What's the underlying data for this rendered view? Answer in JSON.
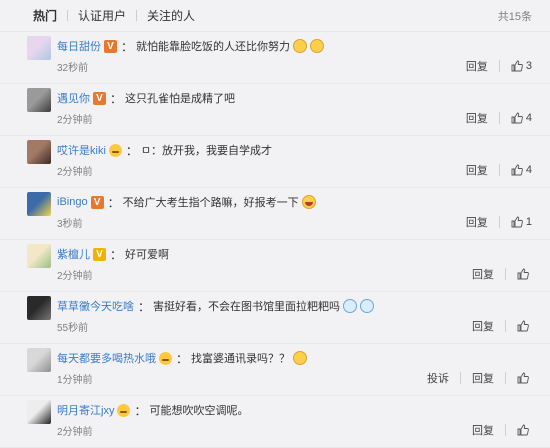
{
  "tabs": [
    {
      "label": "热门",
      "active": true
    },
    {
      "label": "认证用户",
      "active": false
    },
    {
      "label": "关注的人",
      "active": false
    }
  ],
  "total": "共15条",
  "reply_label": "回复",
  "report_label": "投诉",
  "comments": [
    {
      "name": "每日甜份",
      "badge": "V",
      "text": "就怕能靠脸吃饭的人还比你努力",
      "emojis": [
        "face",
        "face"
      ],
      "time": "32秒前",
      "likes": "3",
      "avatar_colors": [
        "#e8d6ef",
        "#b0c6e0"
      ]
    },
    {
      "name": "遇见你",
      "badge": "V",
      "text": "这只孔雀怕是成精了吧",
      "emojis": [],
      "time": "2分钟前",
      "likes": "4",
      "avatar_colors": [
        "#9a9a9a",
        "#3c3c3c"
      ]
    },
    {
      "name": "哎许是kiki",
      "badge": "face",
      "text": "ㅁ：放开我，我要自学成才",
      "emojis": [],
      "time": "2分钟前",
      "likes": "4",
      "avatar_colors": [
        "#a27866",
        "#3b2a24"
      ]
    },
    {
      "name": "iBingo",
      "badge": "V",
      "text": "不给广大考生指个路嘛，好报考一下",
      "emojis": [
        "laugh"
      ],
      "time": "3秒前",
      "likes": "1",
      "avatar_colors": [
        "#3d6aa8",
        "#f4d64a"
      ]
    },
    {
      "name": "紫檀儿",
      "badge": "Vy",
      "text": "好可爱啊",
      "emojis": [],
      "time": "2分钟前",
      "likes": "",
      "avatar_colors": [
        "#f2e8c8",
        "#9bbf86"
      ]
    },
    {
      "name": "草草黴今天吃啥",
      "badge": "",
      "text": "害挺好看，不会在图书馆里面拉粑粑吗",
      "emojis": [
        "blue",
        "blue"
      ],
      "time": "55秒前",
      "likes": "",
      "avatar_colors": [
        "#2a2a2a",
        "#777777"
      ]
    },
    {
      "name": "每天都要多喝热水哦",
      "badge": "face",
      "text": "找富婆通讯录吗？？",
      "emojis": [
        "face"
      ],
      "time": "1分钟前",
      "likes": "",
      "report": true,
      "avatar_colors": [
        "#d8d8d8",
        "#8e8e8e"
      ]
    },
    {
      "name": "明月寄江jxy",
      "badge": "face",
      "text": "可能想吹吹空调呢。",
      "emojis": [],
      "time": "2分钟前",
      "likes": "",
      "avatar_colors": [
        "#ededed",
        "#222222"
      ]
    }
  ]
}
